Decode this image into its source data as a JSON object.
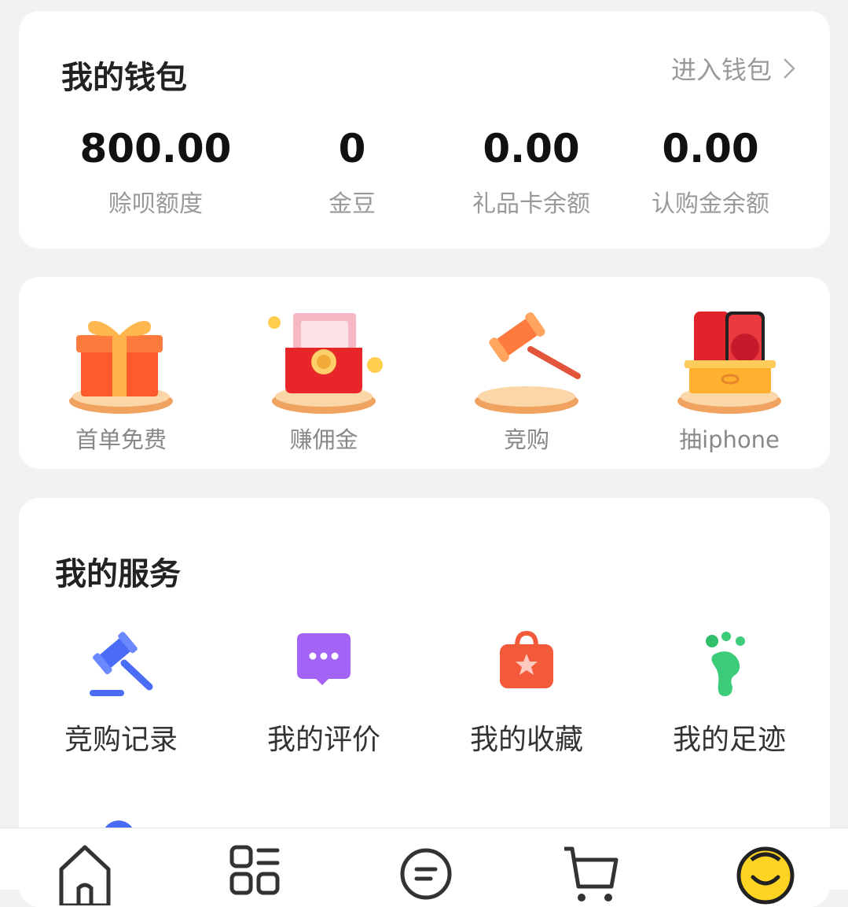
{
  "wallet": {
    "title": "我的钱包",
    "enter_link": "进入钱包",
    "stats": [
      {
        "value": "800.00",
        "label": "赊呗额度"
      },
      {
        "value": "0",
        "label": "金豆"
      },
      {
        "value": "0.00",
        "label": "礼品卡余额"
      },
      {
        "value": "0.00",
        "label": "认购金余额"
      }
    ]
  },
  "promos": [
    {
      "label": "首单免费",
      "icon": "gift-box-icon"
    },
    {
      "label": "赚佣金",
      "icon": "red-envelope-icon"
    },
    {
      "label": "竞购",
      "icon": "auction-hammer-icon"
    },
    {
      "label": "抽iphone",
      "icon": "iphone-box-icon"
    }
  ],
  "services": {
    "title": "我的服务",
    "items": [
      {
        "label": "竞购记录",
        "icon": "gavel-icon",
        "color": "#4a6cf7"
      },
      {
        "label": "我的评价",
        "icon": "chat-bubble-icon",
        "color": "#a364f5"
      },
      {
        "label": "我的收藏",
        "icon": "star-bag-icon",
        "color": "#f25a3a"
      },
      {
        "label": "我的足迹",
        "icon": "footprint-icon",
        "color": "#3dcc7a"
      }
    ]
  },
  "tabbar": {
    "items": [
      {
        "icon": "home-icon"
      },
      {
        "icon": "category-icon"
      },
      {
        "icon": "message-icon"
      },
      {
        "icon": "cart-icon"
      },
      {
        "icon": "profile-avatar-icon"
      }
    ]
  }
}
